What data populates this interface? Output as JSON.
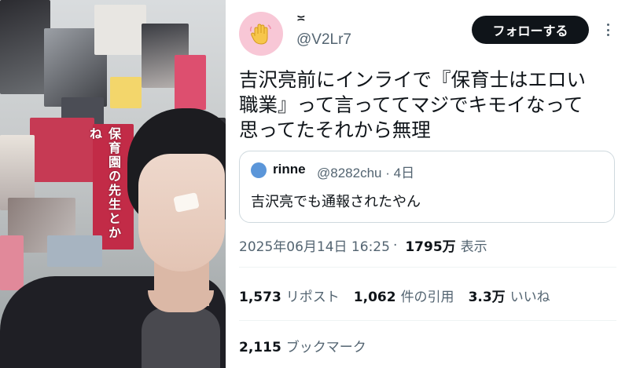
{
  "photo": {
    "overlay_text": "保育園の先生とかね"
  },
  "author": {
    "display_name": "≍",
    "handle": "@V2Lr7",
    "avatar_icon": "waving-hand-icon",
    "follow_label": "フォローする"
  },
  "tweet": {
    "text": "吉沢亮前にインライで『保育士はエロい\n職業』って言っててマジでキモイなって\n思ってたそれから無理"
  },
  "quote": {
    "name": "rinne",
    "handle": "@8282chu",
    "dot": "·",
    "age": "4日",
    "text": "吉沢亮でも通報されたやん"
  },
  "meta": {
    "timestamp": "2025年06月14日 16:25",
    "dot": "·",
    "views": "1795万",
    "views_label": "表示"
  },
  "stats": {
    "reposts": {
      "count": "1,573",
      "label": "リポスト"
    },
    "quotes": {
      "count": "1,062",
      "label": "件の引用"
    },
    "likes": {
      "count": "3.3万",
      "label": "いいね"
    },
    "bookmarks": {
      "count": "2,115",
      "label": "ブックマーク"
    }
  },
  "colors": {
    "text": "#0f1419",
    "secondary": "#536471",
    "button_bg": "#0f1419",
    "avatar_bg": "#f8c7d6",
    "quote_avatar": "#5b96d9",
    "border": "#cfd9de"
  }
}
